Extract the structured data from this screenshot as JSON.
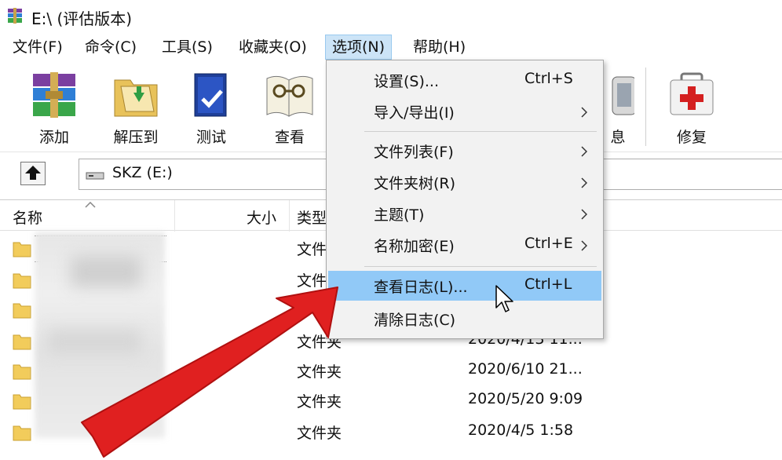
{
  "window": {
    "title": "E:\\ (评估版本)"
  },
  "menubar": {
    "file": "文件(F)",
    "commands": "命令(C)",
    "tools": "工具(S)",
    "favorites": "收藏夹(O)",
    "options": "选项(N)",
    "help": "帮助(H)"
  },
  "toolbar": {
    "add": "添加",
    "extract_to": "解压到",
    "test": "测试",
    "view": "查看",
    "info_partial": "息",
    "repair": "修复"
  },
  "address": {
    "path": "SKZ (E:)"
  },
  "columns": {
    "name": "名称",
    "size": "大小",
    "type": "类型"
  },
  "rows": [
    {
      "type": "文件",
      "date": ""
    },
    {
      "type": "文件",
      "date": ""
    },
    {
      "type": "",
      "date": ""
    },
    {
      "type": "文件夹",
      "date": "2020/4/13 11..."
    },
    {
      "type": "文件夹",
      "date": "2020/6/10 21..."
    },
    {
      "type": "文件夹",
      "date": "2020/5/20 9:09"
    },
    {
      "type": "文件夹",
      "date": "2020/4/5 1:58"
    }
  ],
  "options_menu": {
    "settings": {
      "label": "设置(S)...",
      "shortcut": "Ctrl+S"
    },
    "import_export": {
      "label": "导入/导出(I)"
    },
    "file_list": {
      "label": "文件列表(F)"
    },
    "folder_tree": {
      "label": "文件夹树(R)"
    },
    "themes": {
      "label": "主题(T)"
    },
    "name_encryption": {
      "label": "名称加密(E)",
      "shortcut": "Ctrl+E"
    },
    "view_log": {
      "label": "查看日志(L)...",
      "shortcut": "Ctrl+L"
    },
    "clear_log": {
      "label": "清除日志(C)"
    }
  },
  "colors": {
    "menu_highlight": "#91c9f7",
    "arrow_red": "#e02020",
    "active_menu": "#cce4f7"
  }
}
